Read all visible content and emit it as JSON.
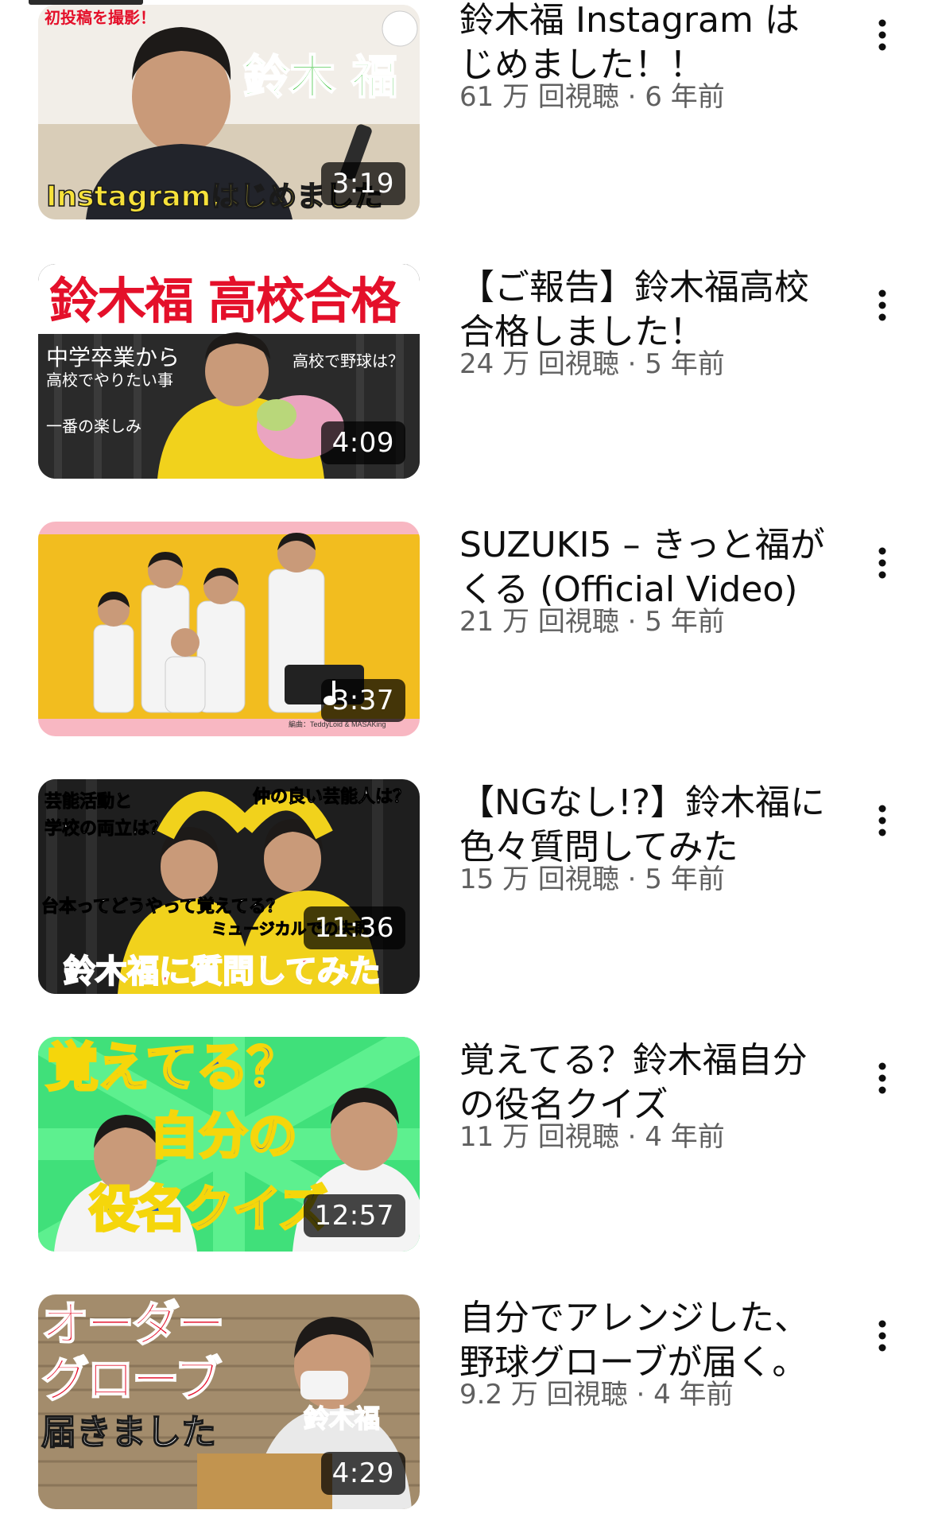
{
  "videos": [
    {
      "title": "鈴木福 Instagram はじめました！！",
      "meta": "61 万 回視聴 · 6 年前",
      "duration": "3:19",
      "has_music_icon": false,
      "thumb_text": {
        "corner": "初投稿を撮影！",
        "name": "鈴木 福",
        "bottom": "Instagramはじめました"
      }
    },
    {
      "title": "【ご報告】鈴木福高校合格しました！",
      "meta": "24 万 回視聴 · 5 年前",
      "duration": "4:09",
      "has_music_icon": false,
      "thumb_text": {
        "headline": "鈴木福 高校合格",
        "left_line1": "中学卒業から",
        "left_line2": "高校でやりたい事",
        "right": "高校で野球は？",
        "bottom_left": "一番の楽しみ"
      }
    },
    {
      "title": "SUZUKI5 – きっと福がくる (Official Video)",
      "meta": "21 万 回視聴 · 5 年前",
      "duration": "3:37",
      "has_music_icon": true,
      "thumb_text": {
        "credit": "編曲：TeddyLoid & MASAKing"
      }
    },
    {
      "title": "【NGなし!?】鈴木福に色々質問してみた",
      "meta": "15 万 回視聴 · 5 年前",
      "duration": "11:36",
      "has_music_icon": false,
      "thumb_text": {
        "left_line1": "芸能活動と",
        "left_line2": "学校の両立は？",
        "right": "仲の良い芸能人は？",
        "mid": "台本ってどうやって覚えてる？",
        "mid2": "ミュージカルでの失敗談",
        "bottom": "鈴木福に質問してみた"
      }
    },
    {
      "title": "覚えてる？鈴木福自分の役名クイズ",
      "meta": "11 万 回視聴 · 4 年前",
      "duration": "12:57",
      "has_music_icon": false,
      "thumb_text": {
        "line1": "覚えてる？",
        "line2": "自分の",
        "line3": "役名クイズ"
      }
    },
    {
      "title": "自分でアレンジした、野球グローブが届く。",
      "meta": "9.2 万 回視聴 · 4 年前",
      "duration": "4:29",
      "has_music_icon": false,
      "thumb_text": {
        "line1": "オーダー",
        "line2": "グローブ",
        "line3": "届きました",
        "name": "鈴木福"
      }
    }
  ],
  "colors": {
    "title": "#0f0f0f",
    "meta": "#606060",
    "duration_bg": "#000000b8"
  },
  "icons": {
    "more": "more-vert-icon",
    "music": "music-note-icon"
  }
}
